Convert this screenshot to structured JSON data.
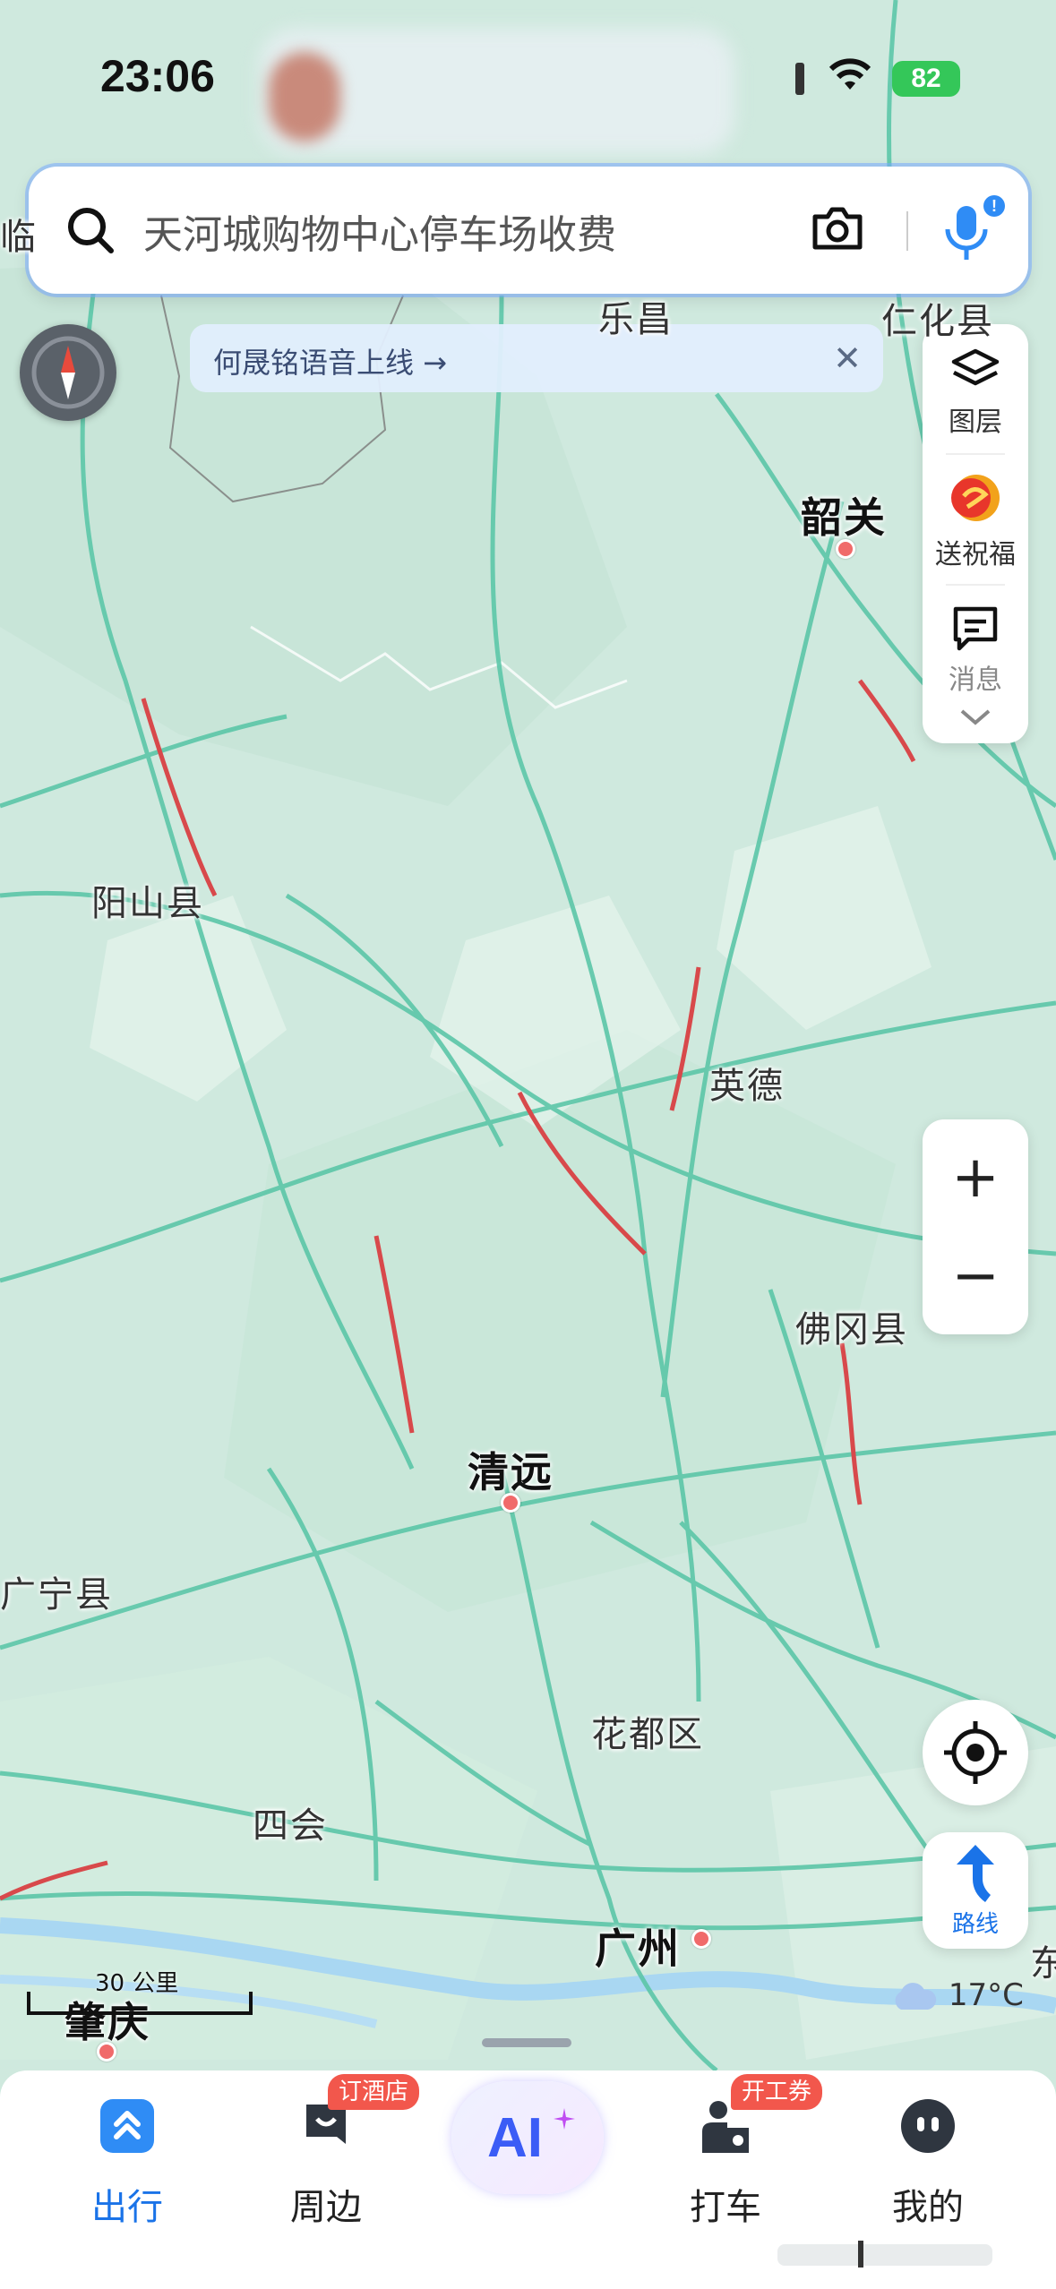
{
  "status_bar": {
    "time": "23:06",
    "battery": "82"
  },
  "search": {
    "placeholder": "天河城购物中心停车场收费"
  },
  "banner": {
    "text": "何晟铭语音上线 →",
    "close": "✕"
  },
  "side_panel": {
    "layers": "图层",
    "blessing": "送祝福",
    "messages": "消息"
  },
  "zoom": {
    "in": "+",
    "out": "−"
  },
  "route_button": {
    "label": "路线"
  },
  "map_labels": {
    "lechang": "乐昌",
    "renhua": "仁化县",
    "shaoguan": "韶关",
    "yangshan": "阳山县",
    "yingde": "英德",
    "fogang": "佛冈县",
    "qingyuan": "清远",
    "guangning": "广宁县",
    "huadu": "花都区",
    "sihui": "四会",
    "guangzhou": "广州",
    "zhaoqing": "肇庆",
    "edge_left": "临",
    "edge_right": "东"
  },
  "scale": {
    "label": "30 公里"
  },
  "weather": {
    "temp": "17°C"
  },
  "tabs": [
    {
      "label": "出行",
      "active": true
    },
    {
      "label": "周边",
      "badge": "订酒店"
    },
    {
      "label": "AI"
    },
    {
      "label": "打车",
      "badge": "开工券"
    },
    {
      "label": "我的"
    }
  ],
  "colors": {
    "map_bg": "#cfe9de",
    "road": "#5cc6a8",
    "traffic_red": "#d8494b",
    "accent": "#1a73e8",
    "badge": "#f2574c"
  }
}
